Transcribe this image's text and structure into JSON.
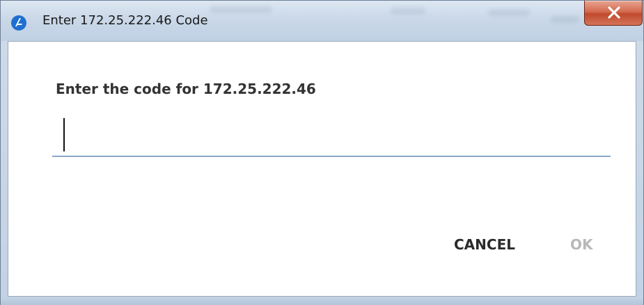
{
  "window": {
    "title": "Enter 172.25.222.46 Code",
    "app_icon": "app-logo-icon",
    "close_icon": "close-icon"
  },
  "dialog": {
    "prompt": "Enter the code for 172.25.222.46",
    "code_input": {
      "value": "",
      "placeholder": ""
    },
    "buttons": {
      "cancel_label": "CANCEL",
      "ok_label": "OK",
      "ok_enabled": false
    }
  },
  "colors": {
    "close_button": "#c9553a",
    "input_underline": "#8aa6c9",
    "app_icon": "#1f6fd1",
    "disabled_text": "#b8b8b8"
  }
}
